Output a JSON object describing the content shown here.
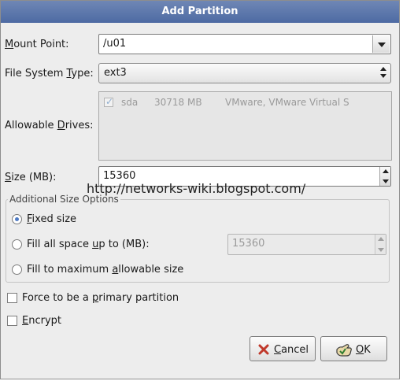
{
  "dialog": {
    "title": "Add Partition"
  },
  "mount_point": {
    "label": "Mount Point:",
    "value": "/u01"
  },
  "fs_type": {
    "label": "File System Type:",
    "value": "ext3"
  },
  "drives": {
    "label": "Allowable Drives:",
    "items": [
      {
        "name": "sda",
        "size": "30718 MB",
        "model": "VMware, VMware Virtual S",
        "checked": true
      }
    ]
  },
  "size": {
    "label": "Size (MB):",
    "value": "15360"
  },
  "watermark": "http://networks-wiki.blogspot.com/",
  "size_options": {
    "title": "Additional Size Options",
    "fixed": "Fixed size",
    "fill_up_to": "Fill all space up to (MB):",
    "fill_up_to_value": "15360",
    "fill_max": "Fill to maximum allowable size"
  },
  "primary": {
    "label": "Force to be a primary partition"
  },
  "encrypt": {
    "label": "Encrypt"
  },
  "buttons": {
    "cancel": "Cancel",
    "ok": "OK"
  },
  "icons": {
    "cancel": "cancel-x-icon",
    "ok": "ok-hand-icon"
  },
  "colors": {
    "title_bar": "#5a74a8",
    "radio_selected": "#4f7bc4"
  }
}
